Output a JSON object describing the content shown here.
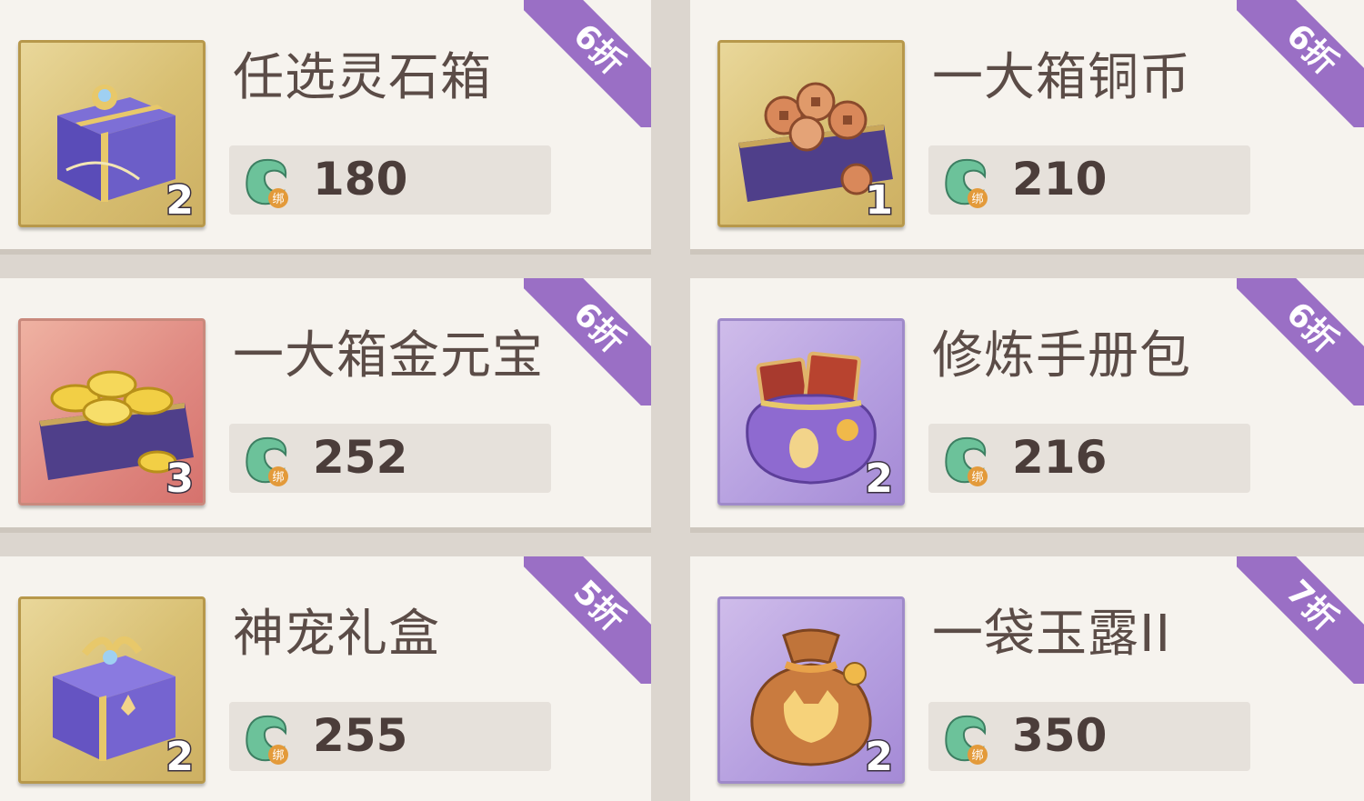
{
  "colors": {
    "card_bg": "#f6f3ee",
    "price_bg": "#e6e1db",
    "ribbon": "#9a6fc5",
    "title_text": "#5b4c47",
    "price_text": "#4b3d3a"
  },
  "currency": {
    "icon": "jade-dragon-coin-icon",
    "badge": "绑"
  },
  "items": [
    {
      "name": "任选灵石箱",
      "price": "180",
      "qty": "2",
      "discount": "6折",
      "frame": "gold",
      "icon": "gift-box-icon"
    },
    {
      "name": "一大箱铜币",
      "price": "210",
      "qty": "1",
      "discount": "6折",
      "frame": "gold",
      "icon": "copper-coin-chest-icon"
    },
    {
      "name": "一大箱金元宝",
      "price": "252",
      "qty": "3",
      "discount": "6折",
      "frame": "red",
      "icon": "gold-ingot-chest-icon"
    },
    {
      "name": "修炼手册包",
      "price": "216",
      "qty": "2",
      "discount": "6折",
      "frame": "purple",
      "icon": "manual-bag-icon"
    },
    {
      "name": "神宠礼盒",
      "price": "255",
      "qty": "2",
      "discount": "5折",
      "frame": "gold",
      "icon": "pet-gift-box-icon"
    },
    {
      "name": "一袋玉露II",
      "price": "350",
      "qty": "2",
      "discount": "7折",
      "frame": "purple",
      "icon": "jade-dew-bag-icon"
    }
  ]
}
